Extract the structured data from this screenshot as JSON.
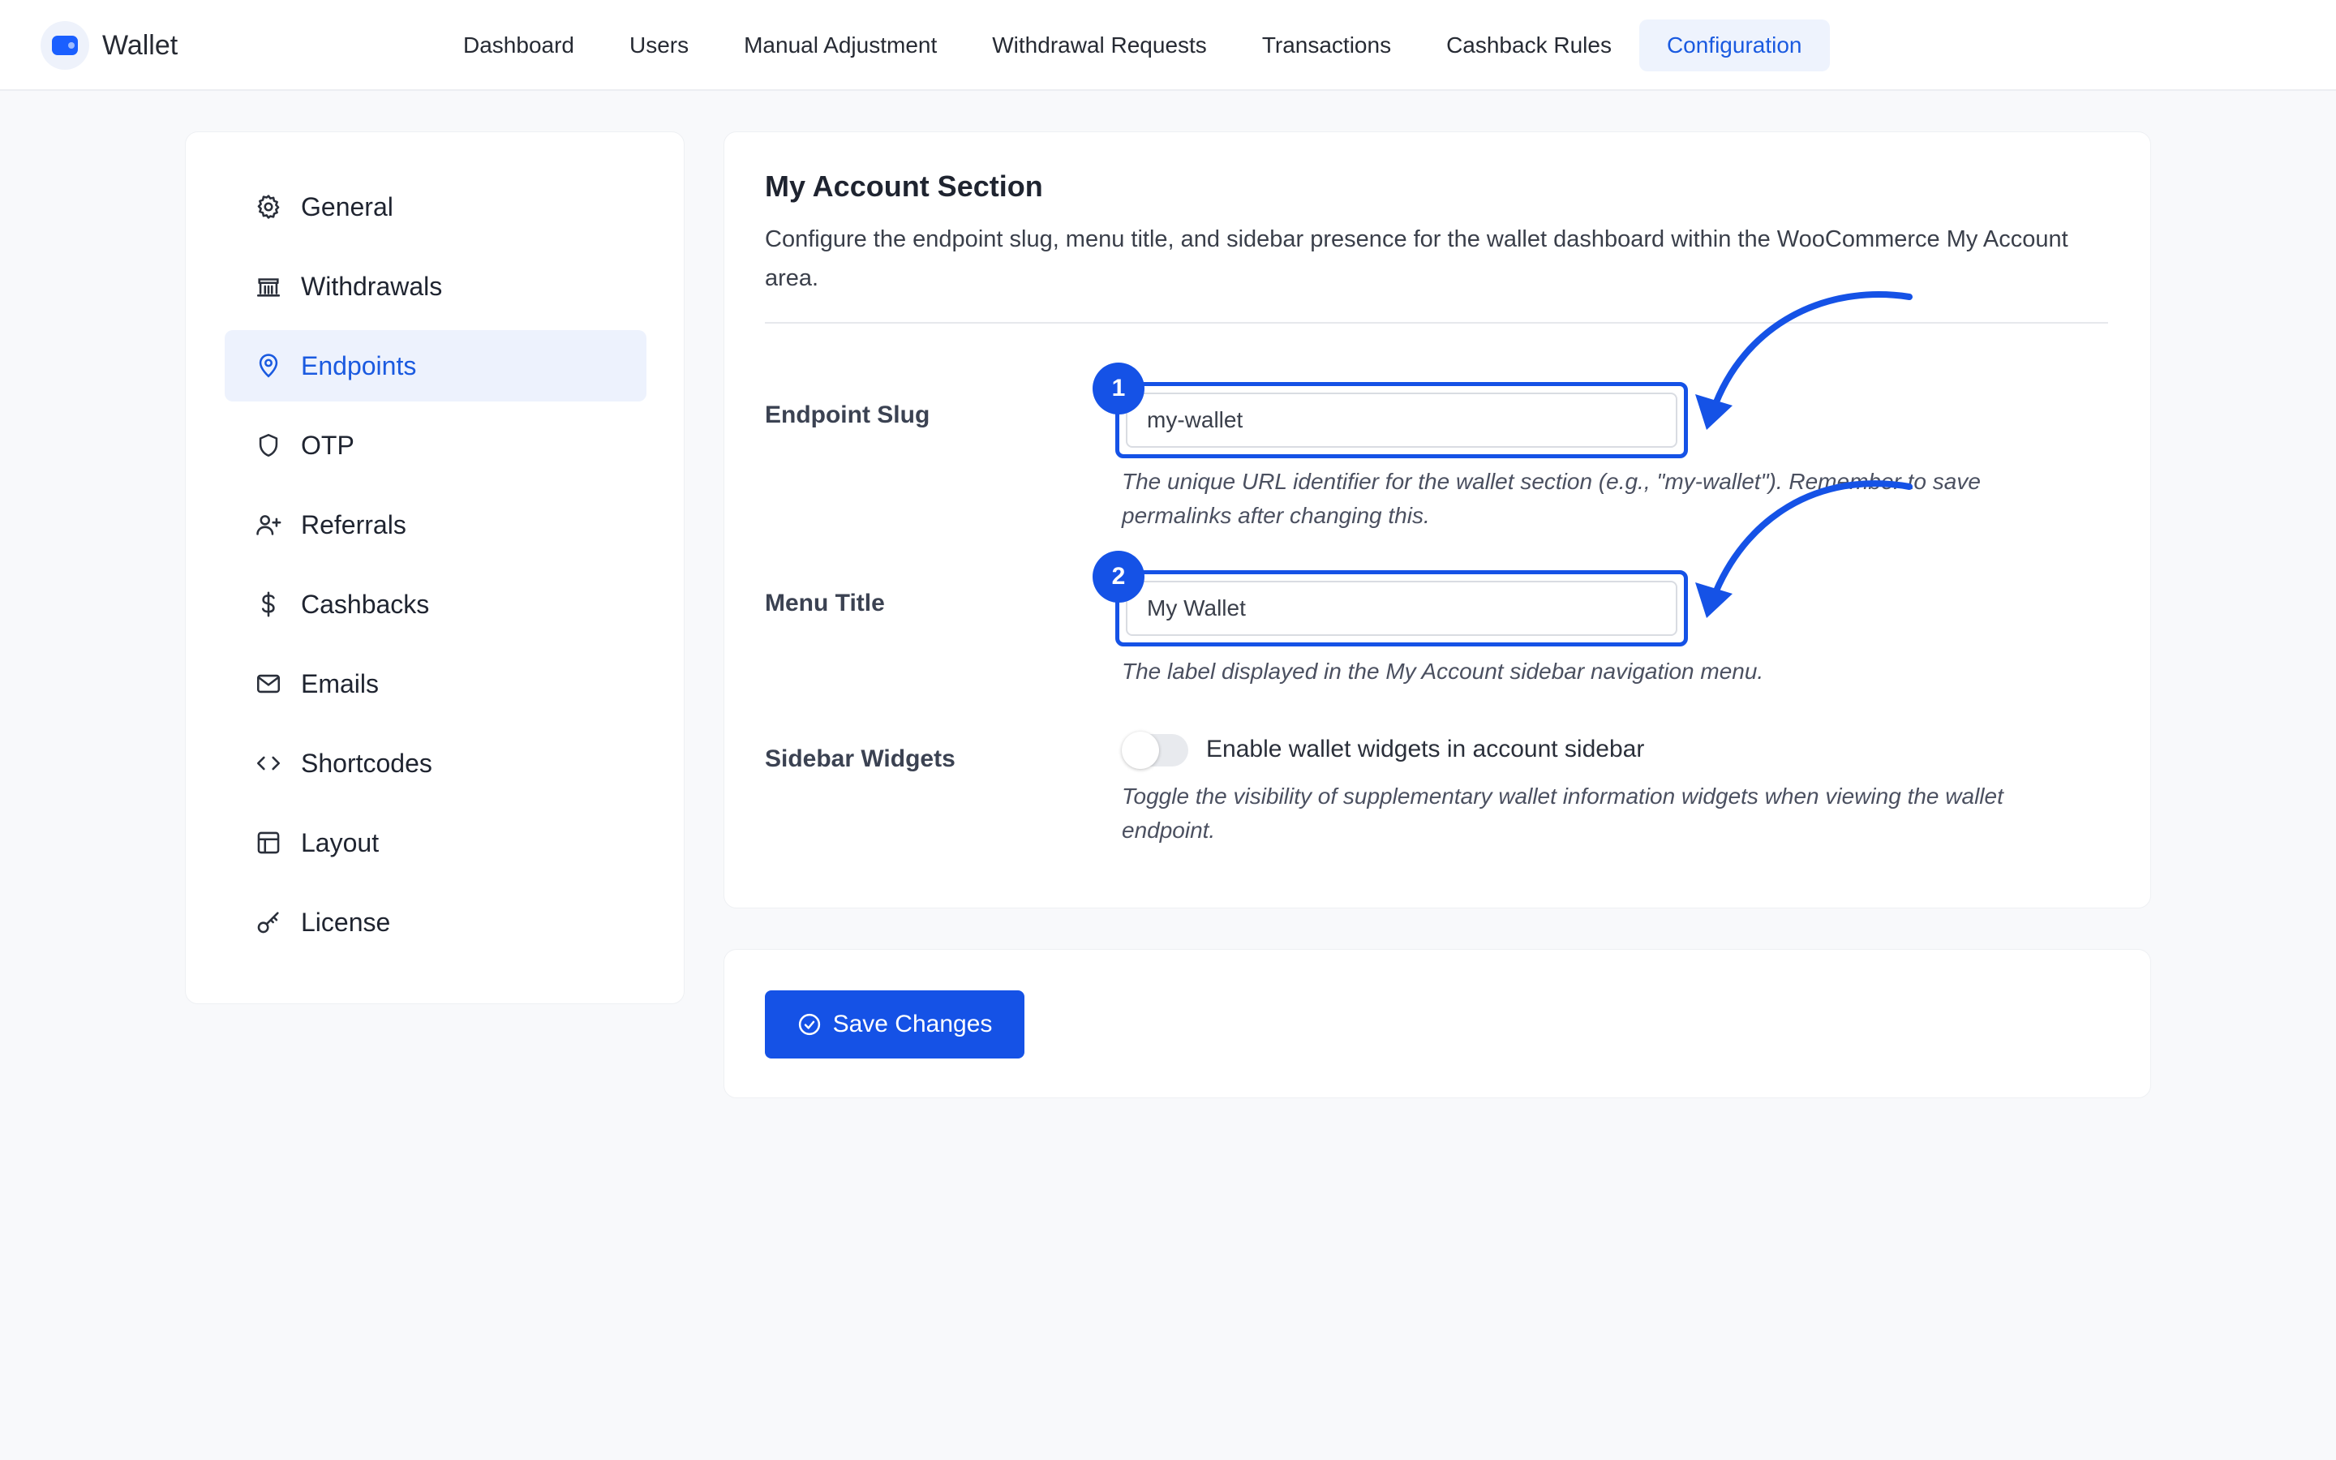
{
  "app": {
    "name": "Wallet"
  },
  "nav": [
    {
      "label": "Dashboard"
    },
    {
      "label": "Users"
    },
    {
      "label": "Manual Adjustment"
    },
    {
      "label": "Withdrawal Requests"
    },
    {
      "label": "Transactions"
    },
    {
      "label": "Cashback Rules"
    },
    {
      "label": "Configuration"
    }
  ],
  "sidebar": {
    "items": [
      {
        "label": "General",
        "icon": "gear-icon"
      },
      {
        "label": "Withdrawals",
        "icon": "bank-icon"
      },
      {
        "label": "Endpoints",
        "icon": "map-pin-icon"
      },
      {
        "label": "OTP",
        "icon": "shield-icon"
      },
      {
        "label": "Referrals",
        "icon": "user-plus-icon"
      },
      {
        "label": "Cashbacks",
        "icon": "dollar-icon"
      },
      {
        "label": "Emails",
        "icon": "mail-icon"
      },
      {
        "label": "Shortcodes",
        "icon": "code-icon"
      },
      {
        "label": "Layout",
        "icon": "layout-icon"
      },
      {
        "label": "License",
        "icon": "key-icon"
      }
    ]
  },
  "section": {
    "title": "My Account Section",
    "description": "Configure the endpoint slug, menu title, and sidebar presence for the wallet dashboard within the WooCommerce My Account area."
  },
  "fields": {
    "endpoint_slug": {
      "label": "Endpoint Slug",
      "value": "my-wallet",
      "badge": "1",
      "help": "The unique URL identifier for the wallet section (e.g., \"my-wallet\"). Remember to save permalinks after changing this."
    },
    "menu_title": {
      "label": "Menu Title",
      "value": "My Wallet",
      "badge": "2",
      "help": "The label displayed in the My Account sidebar navigation menu."
    },
    "sidebar_widgets": {
      "label": "Sidebar Widgets",
      "toggle_label": "Enable wallet widgets in account sidebar",
      "enabled": false,
      "help": "Toggle the visibility of supplementary wallet information widgets when viewing the wallet endpoint."
    }
  },
  "actions": {
    "save_label": "Save Changes"
  },
  "colors": {
    "accent": "#1552e6",
    "active_nav_bg": "#eef3fd"
  }
}
